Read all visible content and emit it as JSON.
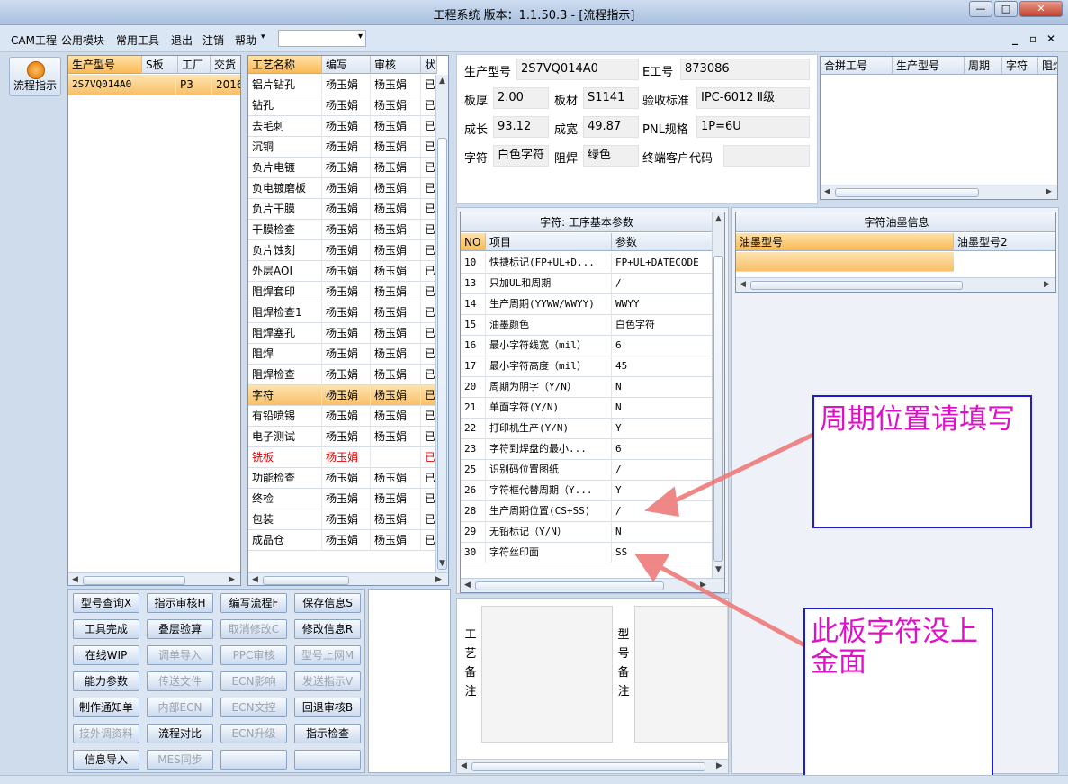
{
  "window": {
    "title": "工程系统  版本：1.1.50.3 - [流程指示]",
    "min": "—",
    "max": "□",
    "close": "✕"
  },
  "menu": [
    "CAM工程",
    "公用模块",
    "常用工具",
    "退出",
    "注销",
    "帮助"
  ],
  "menu_right": {
    "min": "_",
    "restore": "▫",
    "close": "✕"
  },
  "sidebar": {
    "flow_label": "流程指示"
  },
  "model_grid": {
    "headers": [
      "生产型号",
      "S板",
      "工厂",
      "交货"
    ],
    "rows": [
      [
        "2S7VQ014A0",
        "",
        "P3",
        "2016"
      ]
    ]
  },
  "process_grid": {
    "headers": [
      "工艺名称",
      "编写",
      "审核",
      "状"
    ],
    "rows": [
      [
        "铝片钻孔",
        "杨玉娟",
        "杨玉娟",
        "已"
      ],
      [
        "钻孔",
        "杨玉娟",
        "杨玉娟",
        "已"
      ],
      [
        "去毛刺",
        "杨玉娟",
        "杨玉娟",
        "已"
      ],
      [
        "沉铜",
        "杨玉娟",
        "杨玉娟",
        "已"
      ],
      [
        "负片电镀",
        "杨玉娟",
        "杨玉娟",
        "已"
      ],
      [
        "负电镀磨板",
        "杨玉娟",
        "杨玉娟",
        "已"
      ],
      [
        "负片干膜",
        "杨玉娟",
        "杨玉娟",
        "已"
      ],
      [
        "干膜检查",
        "杨玉娟",
        "杨玉娟",
        "已"
      ],
      [
        "负片蚀刻",
        "杨玉娟",
        "杨玉娟",
        "已"
      ],
      [
        "外层AOI",
        "杨玉娟",
        "杨玉娟",
        "已"
      ],
      [
        "阻焊套印",
        "杨玉娟",
        "杨玉娟",
        "已"
      ],
      [
        "阻焊检查1",
        "杨玉娟",
        "杨玉娟",
        "已"
      ],
      [
        "阻焊塞孔",
        "杨玉娟",
        "杨玉娟",
        "已"
      ],
      [
        "阻焊",
        "杨玉娟",
        "杨玉娟",
        "已"
      ],
      [
        "阻焊检查",
        "杨玉娟",
        "杨玉娟",
        "已"
      ],
      [
        "字符",
        "杨玉娟",
        "杨玉娟",
        "已"
      ],
      [
        "有铅喷锡",
        "杨玉娟",
        "杨玉娟",
        "已"
      ],
      [
        "电子测试",
        "杨玉娟",
        "杨玉娟",
        "已"
      ],
      [
        "铣板",
        "杨玉娟",
        "",
        "已"
      ],
      [
        "功能检查",
        "杨玉娟",
        "杨玉娟",
        "已"
      ],
      [
        "终检",
        "杨玉娟",
        "杨玉娟",
        "已"
      ],
      [
        "包装",
        "杨玉娟",
        "杨玉娟",
        "已"
      ],
      [
        "成品仓",
        "杨玉娟",
        "杨玉娟",
        "已"
      ]
    ],
    "selected_index": 15,
    "red_index": 18
  },
  "buttons": [
    [
      "型号查询X",
      "指示审核H",
      "编写流程F",
      "保存信息S"
    ],
    [
      "工具完成",
      "叠层验算",
      "取消修改C",
      "修改信息R"
    ],
    [
      "在线WIP",
      "调单导入",
      "PPC审核",
      "型号上网M"
    ],
    [
      "能力参数",
      "传送文件",
      "ECN影响",
      "发送指示V"
    ],
    [
      "制作通知单",
      "内部ECN",
      "ECN文控",
      "回退审核B"
    ],
    [
      "接外调资料",
      "流程对比",
      "ECN升级",
      "指示检查"
    ],
    [
      "信息导入",
      "MES同步",
      "",
      ""
    ]
  ],
  "buttons_disabled": [
    [
      1,
      2
    ],
    [
      2,
      1
    ],
    [
      2,
      2
    ],
    [
      2,
      3
    ],
    [
      3,
      1
    ],
    [
      3,
      2
    ],
    [
      3,
      3
    ],
    [
      4,
      1
    ],
    [
      4,
      2
    ],
    [
      5,
      0
    ],
    [
      5,
      2
    ],
    [
      6,
      1
    ]
  ],
  "info": {
    "model_label": "生产型号",
    "model": "2S7VQ014A0",
    "e_label": "E工号",
    "e_no": "873086",
    "thick_label": "板厚",
    "thick": "2.00",
    "mat_label": "板材",
    "mat": "S1141",
    "std_label": "验收标准",
    "std": "IPC-6012 Ⅱ级",
    "len_label": "成长",
    "len": "93.12",
    "wid_label": "成宽",
    "wid": "49.87",
    "pnl_label": "PNL规格",
    "pnl": "1P=6U",
    "char_label": "字符",
    "char": "白色字符",
    "mask_label": "阻焊",
    "mask": "绿色",
    "cust_label": "终端客户代码",
    "cust": ""
  },
  "combine_grid": {
    "headers": [
      "合拼工号",
      "生产型号",
      "周期",
      "字符",
      "阻焊"
    ]
  },
  "params": {
    "title": "字符: 工序基本参数",
    "headers": [
      "NO",
      "项目",
      "参数"
    ],
    "rows": [
      [
        "10",
        "快捷标记(FP+UL+D...",
        "FP+UL+DATECODE"
      ],
      [
        "13",
        "只加UL和周期",
        "/"
      ],
      [
        "14",
        "生产周期(YYWW/WWYY)",
        "WWYY"
      ],
      [
        "15",
        "油墨颜色",
        "白色字符"
      ],
      [
        "16",
        "最小字符线宽（mil）",
        "6"
      ],
      [
        "17",
        "最小字符高度（mil）",
        "45"
      ],
      [
        "20",
        "周期为阴字（Y/N）",
        "N"
      ],
      [
        "21",
        "单面字符(Y/N)",
        "N"
      ],
      [
        "22",
        "打印机生产(Y/N)",
        "Y"
      ],
      [
        "23",
        "字符到焊盘的最小...",
        "6"
      ],
      [
        "25",
        "识别码位置图纸",
        "/"
      ],
      [
        "26",
        "字符框代替周期（Y...",
        "Y"
      ],
      [
        "28",
        "生产周期位置(CS+SS)",
        "/"
      ],
      [
        "29",
        "无铅标记（Y/N）",
        "N"
      ],
      [
        "30",
        "字符丝印面",
        "SS"
      ]
    ]
  },
  "ink": {
    "title": "字符油墨信息",
    "headers": [
      "油墨型号",
      "油墨型号2"
    ]
  },
  "notes": {
    "process_label": "工艺备注",
    "model_label": "型号备注"
  },
  "annotations": {
    "a1": "周期位置请填写",
    "a2": "此板字符没上金面",
    "color": "#e010c8",
    "border": "#1b1bd0"
  }
}
